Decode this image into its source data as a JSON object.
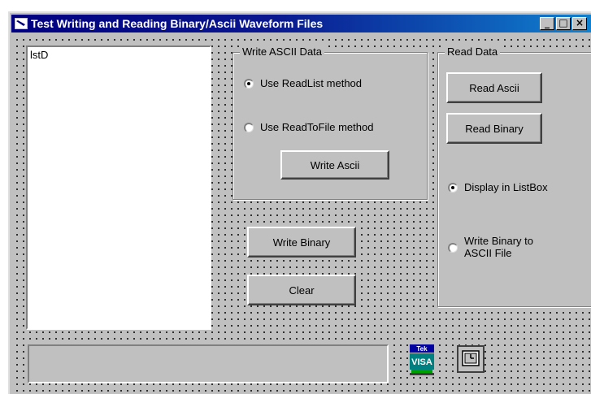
{
  "window": {
    "title": "Test Writing and Reading Binary/Ascii Waveform Files",
    "controls": {
      "minimize": "_",
      "maximize": "□",
      "close": "×"
    }
  },
  "listbox": {
    "text": "lstD"
  },
  "write_ascii_frame": {
    "label": "Write ASCII  Data",
    "radio_readlist": {
      "label": "Use ReadList method",
      "checked": true
    },
    "radio_readtofile": {
      "label": "Use ReadToFile method",
      "checked": false
    },
    "write_ascii_button": "Write Ascii"
  },
  "buttons": {
    "write_binary": "Write Binary",
    "clear": "Clear"
  },
  "read_data_frame": {
    "label": "Read Data",
    "read_ascii_button": "Read Ascii",
    "read_binary_button": "Read Binary",
    "radio_display_listbox": {
      "label": "Display in ListBox",
      "checked": true
    },
    "radio_write_binary_to_ascii": {
      "label_line1": "Write Binary to",
      "label_line2": "ASCII File",
      "checked": false
    }
  },
  "status": {
    "text": ""
  },
  "icons": {
    "visa": "tek-visa-icon",
    "visa_top_label": "Tek",
    "visa_label": "VISA",
    "timer": "timer-icon"
  }
}
